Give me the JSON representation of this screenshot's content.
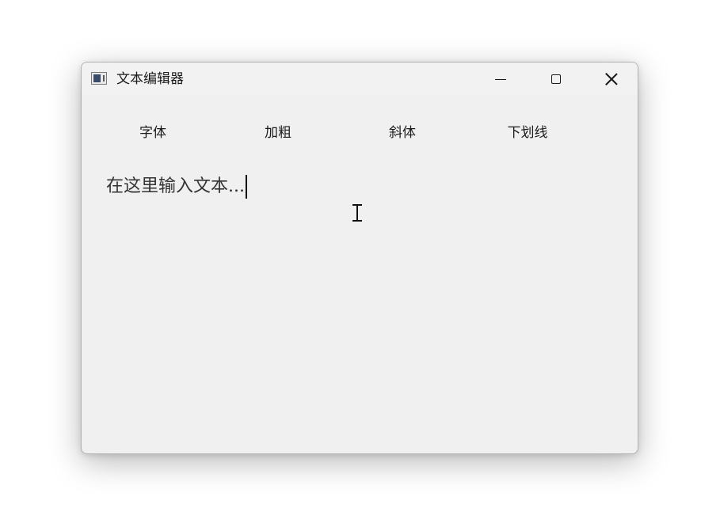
{
  "window": {
    "title": "文本编辑器",
    "icon": "app-window-icon",
    "controls": {
      "minimize_icon": "minimize-icon",
      "maximize_icon": "maximize-icon",
      "close_icon": "close-icon"
    }
  },
  "toolbar": {
    "font_label": "字体",
    "bold_label": "加粗",
    "italic_label": "斜体",
    "underline_label": "下划线"
  },
  "editor": {
    "text": "在这里输入文本..."
  },
  "cursor": {
    "icon": "text-ibeam-cursor-icon"
  }
}
